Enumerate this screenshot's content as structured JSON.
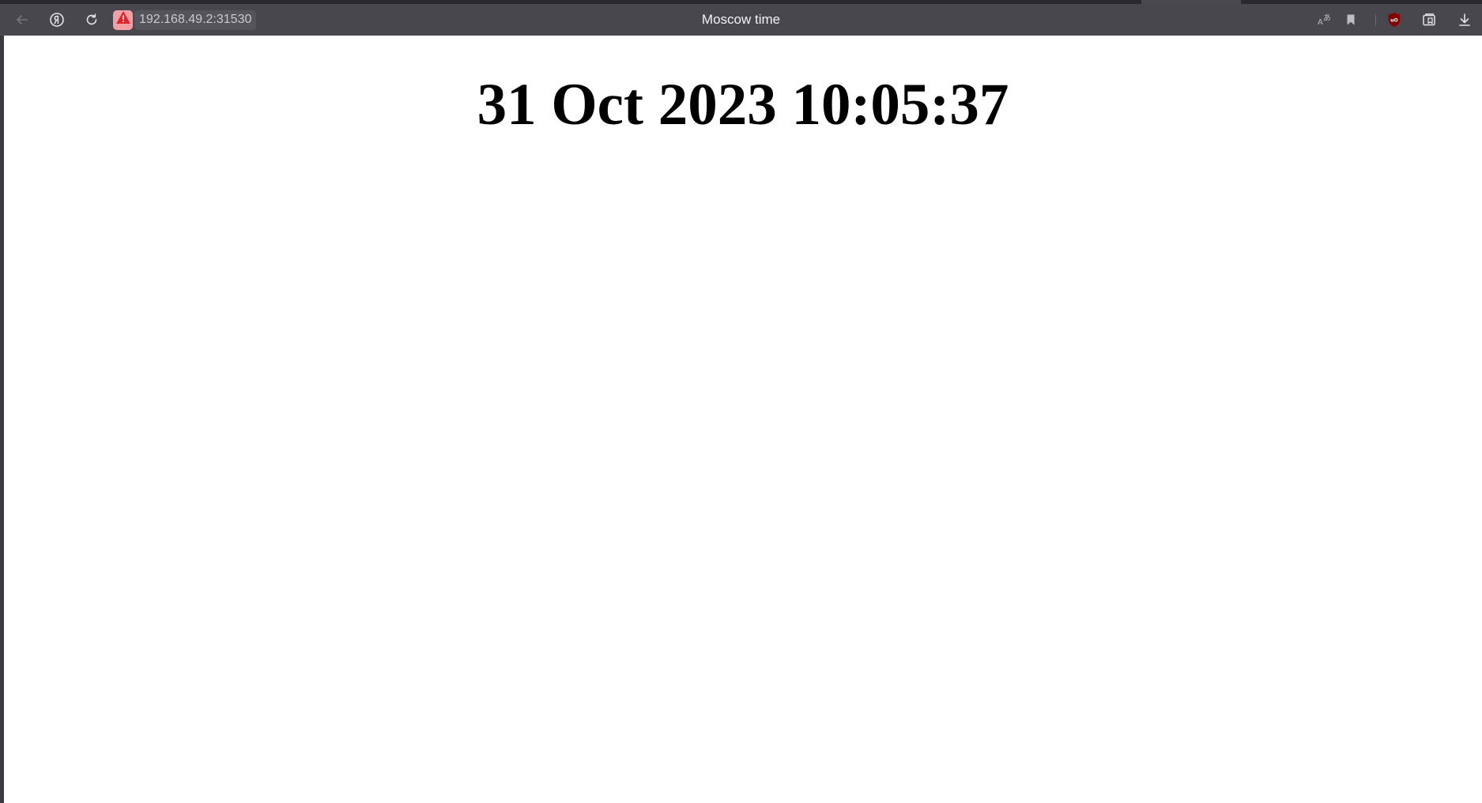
{
  "browser": {
    "tab_title": "Moscow time",
    "address": {
      "url": "192.168.49.2:31530",
      "security_state": "not-secure",
      "security_icon": "warning-triangle-icon"
    },
    "toolbar_left": [
      {
        "name": "back-button",
        "icon": "arrow-left-icon",
        "enabled": false
      },
      {
        "name": "yandex-home-button",
        "icon": "yandex-logo-icon"
      },
      {
        "name": "reload-button",
        "icon": "reload-icon"
      }
    ],
    "toolbar_right": [
      {
        "name": "translate-button",
        "icon": "translate-icon"
      },
      {
        "name": "bookmark-button",
        "icon": "bookmark-icon"
      },
      {
        "name": "ublock-extension-button",
        "icon": "ublock-origin-icon"
      },
      {
        "name": "collections-button",
        "icon": "collections-icon"
      },
      {
        "name": "downloads-button",
        "icon": "download-icon"
      }
    ],
    "colors": {
      "toolbar_bg": "#48474e",
      "security_badge": "#f3a0a5",
      "ublock_red": "#800000"
    }
  },
  "page": {
    "heading": "31 Oct 2023 10:05:37"
  }
}
